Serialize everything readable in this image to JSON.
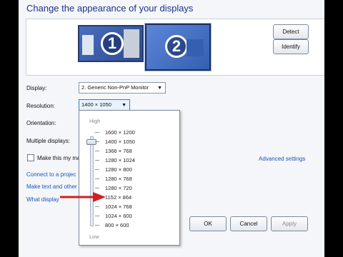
{
  "header": {
    "title": "Change the appearance of your displays"
  },
  "monitors": [
    {
      "number": "1"
    },
    {
      "number": "2"
    }
  ],
  "buttons": {
    "detect": "Detect",
    "identify": "Identify",
    "ok": "OK",
    "cancel": "Cancel",
    "apply": "Apply"
  },
  "form": {
    "display_label": "Display:",
    "display_value": "2. Generic Non-PnP Monitor",
    "resolution_label": "Resolution:",
    "resolution_value": "1400 × 1050",
    "orientation_label": "Orientation:",
    "multiple_label": "Multiple displays:",
    "make_main_label": "Make this my ma"
  },
  "links": {
    "advanced": "Advanced settings",
    "connect": "Connect to a projec",
    "make_text": "Make text and other",
    "what_display": "What display"
  },
  "dropdown": {
    "high": "High",
    "low": "Low",
    "options": [
      "1600 × 1200",
      "1400 × 1050",
      "1366 × 768",
      "1280 × 1024",
      "1280 × 800",
      "1280 × 768",
      "1280 × 720",
      "1152 × 864",
      "1024 × 768",
      "1024 × 600",
      "800 × 600"
    ],
    "selected": "1400 × 1050"
  },
  "colors": {
    "annotation_arrow": "#d21f1f",
    "accent": "#1e3287"
  }
}
